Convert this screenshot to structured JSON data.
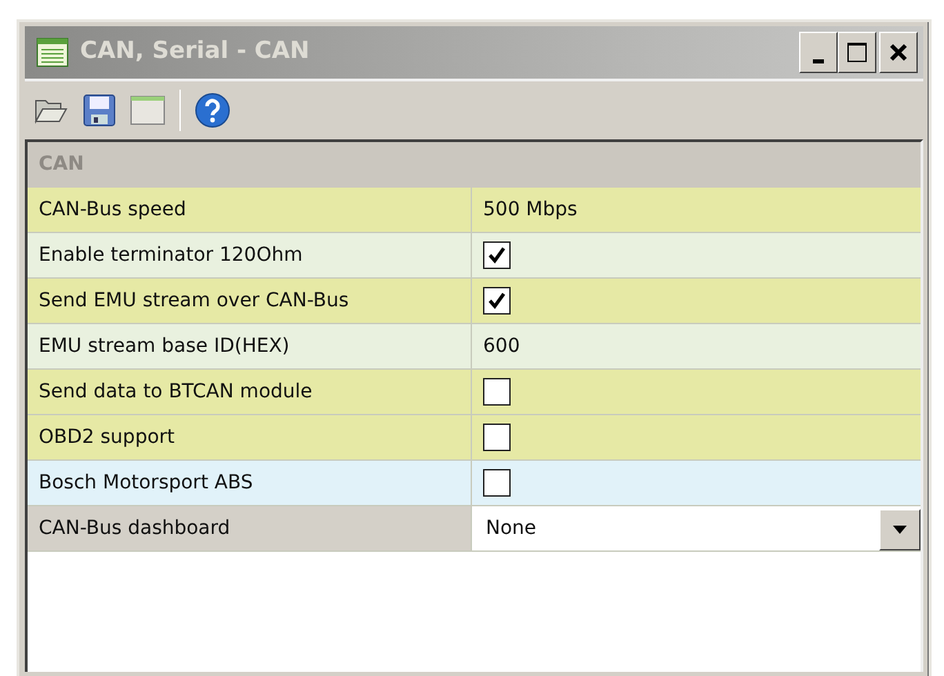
{
  "window": {
    "title": "CAN, Serial - CAN"
  },
  "section": {
    "title": "CAN"
  },
  "rows": [
    {
      "label": "CAN-Bus speed",
      "kind": "text",
      "value": "500 Mbps",
      "color": "#e6e9a5"
    },
    {
      "label": "Enable terminator 120Ohm",
      "kind": "checkbox",
      "checked": true,
      "color": "#e9f1df"
    },
    {
      "label": "Send EMU stream over CAN-Bus",
      "kind": "checkbox",
      "checked": true,
      "color": "#e6e9a5"
    },
    {
      "label": "EMU stream base ID(HEX)",
      "kind": "text",
      "value": "600",
      "color": "#e9f1df"
    },
    {
      "label": "Send data to BTCAN module",
      "kind": "checkbox",
      "checked": false,
      "color": "#e6e9a5"
    },
    {
      "label": "OBD2 support",
      "kind": "checkbox",
      "checked": false,
      "color": "#e6e9a5"
    },
    {
      "label": "Bosch Motorsport ABS",
      "kind": "checkbox",
      "checked": false,
      "color": "#e1f2f9"
    },
    {
      "label": "CAN-Bus dashboard",
      "kind": "dropdown",
      "value": "None",
      "color": "#d4d0c8"
    }
  ]
}
